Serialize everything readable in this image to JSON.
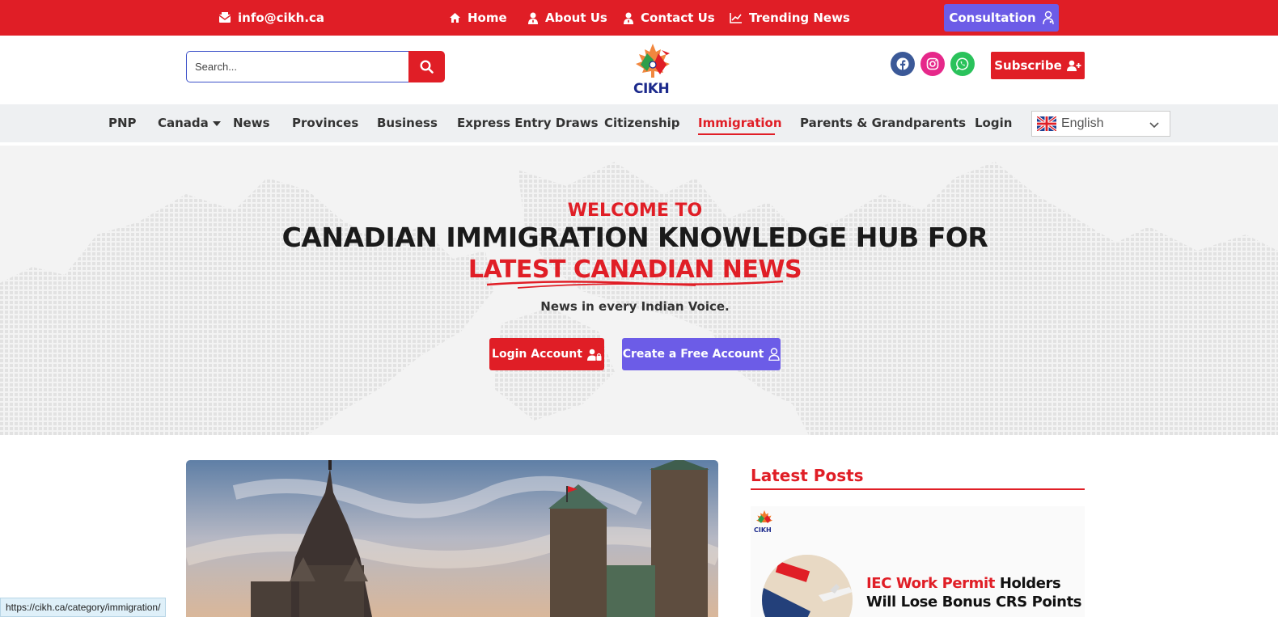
{
  "topbar": {
    "email": "info@cikh.ca",
    "links": [
      "Home",
      "About Us",
      "Contact Us",
      "Trending News"
    ],
    "consultation_label": "Consultation",
    "accent_color": "#e01e26",
    "button_color": "#6c5ce7"
  },
  "header": {
    "search_placeholder": "Search...",
    "logo_text": "CIKH",
    "social": [
      "facebook-icon",
      "instagram-icon",
      "whatsapp-icon"
    ],
    "subscribe_label": "Subscribe"
  },
  "nav": {
    "items": [
      "PNP",
      "Canada",
      "News",
      "Provinces",
      "Business",
      "Express Entry Draws",
      "Citizenship",
      "Immigration",
      "Parents & Grandparents",
      "Login"
    ],
    "active": "Immigration",
    "language": "English"
  },
  "hero": {
    "welcome": "WELCOME TO",
    "headline": "CANADIAN IMMIGRATION KNOWLEDGE HUB FOR",
    "headline_red": "LATEST CANADIAN NEWS",
    "tagline": "News in every Indian Voice.",
    "login_label": "Login Account",
    "create_label": "Create a Free Account"
  },
  "sidebar": {
    "heading": "Latest Posts",
    "post_logo_text": "CIKH",
    "post_title_red": "IEC Work Permit",
    "post_title_rest": " Holders Will Lose Bonus CRS Points"
  },
  "status_bar": {
    "url": "https://cikh.ca/category/immigration/"
  }
}
